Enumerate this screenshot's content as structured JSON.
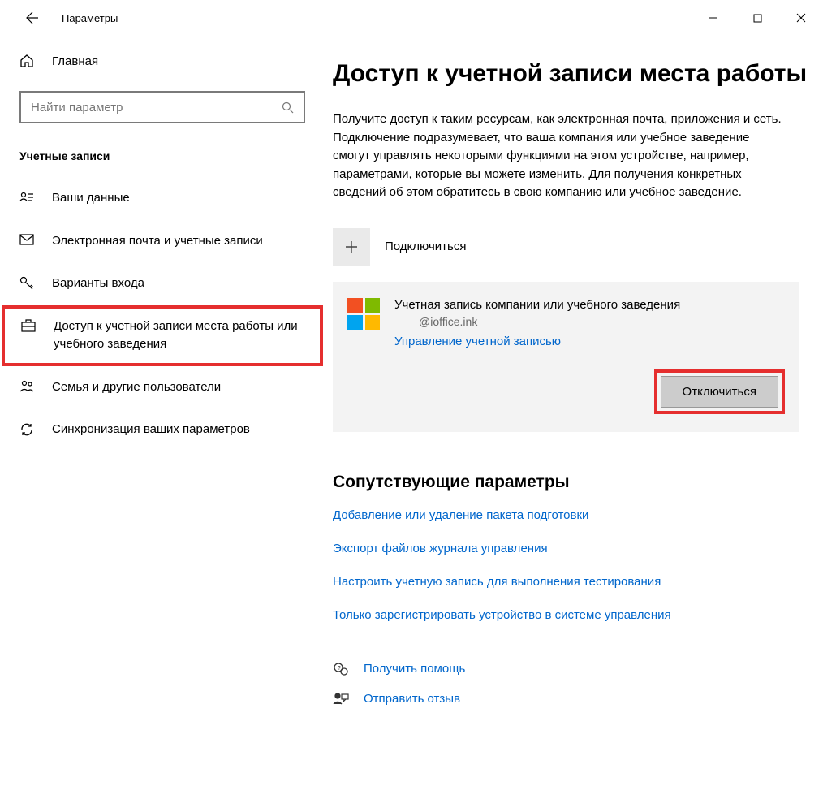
{
  "titlebar": {
    "title": "Параметры"
  },
  "sidebar": {
    "home": "Главная",
    "search_placeholder": "Найти параметр",
    "category": "Учетные записи",
    "items": [
      {
        "label": "Ваши данные"
      },
      {
        "label": "Электронная почта и учетные записи"
      },
      {
        "label": "Варианты входа"
      },
      {
        "label": "Доступ к учетной записи места работы или учебного заведения"
      },
      {
        "label": "Семья и другие пользователи"
      },
      {
        "label": "Синхронизация ваших параметров"
      }
    ]
  },
  "main": {
    "title": "Доступ к учетной записи места работы",
    "description": "Получите доступ к таким ресурсам, как электронная почта, приложения и сеть. Подключение подразумевает, что ваша компания или учебное заведение смогут управлять некоторыми функциями на этом устройстве, например, параметрами, которые вы можете изменить. Для получения конкретных сведений об этом обратитесь в свою компанию или учебное заведение.",
    "connect_label": "Подключиться",
    "account": {
      "title": "Учетная запись компании или учебного заведения",
      "email": "@ioffice.ink",
      "manage": "Управление учетной записью",
      "disconnect": "Отключиться"
    },
    "related": {
      "heading": "Сопутствующие параметры",
      "links": [
        "Добавление или удаление пакета подготовки",
        "Экспорт файлов журнала управления",
        "Настроить учетную запись для выполнения тестирования",
        "Только зарегистрировать устройство в системе управления"
      ]
    },
    "footer": {
      "help": "Получить помощь",
      "feedback": "Отправить отзыв"
    }
  }
}
